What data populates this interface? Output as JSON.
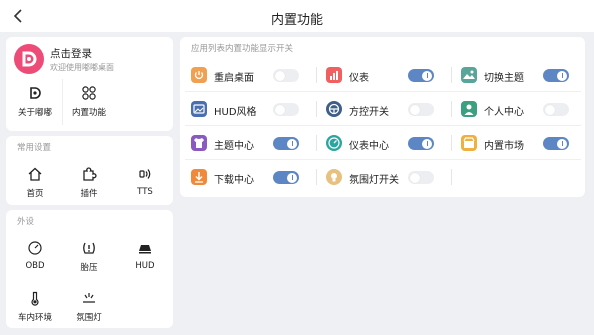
{
  "header": {
    "title": "内置功能"
  },
  "profile": {
    "name": "点击登录",
    "subtitle": "欢迎使用嘟嘟桌面",
    "items": [
      {
        "label": "关于嘟嘟",
        "icon": "dudu-logo-icon"
      },
      {
        "label": "内置功能",
        "icon": "grid-flower-icon"
      }
    ]
  },
  "common": {
    "title": "常用设置",
    "items": [
      {
        "label": "首页",
        "icon": "home-icon"
      },
      {
        "label": "插件",
        "icon": "puzzle-icon"
      },
      {
        "label": "TTS",
        "icon": "voice-icon"
      }
    ]
  },
  "peripherals": {
    "title": "外设",
    "items": [
      {
        "label": "OBD",
        "icon": "gauge-icon"
      },
      {
        "label": "胎压",
        "icon": "tire-pressure-icon"
      },
      {
        "label": "HUD",
        "icon": "hud-icon"
      },
      {
        "label": "车内环境",
        "icon": "thermometer-icon"
      },
      {
        "label": "氛围灯",
        "icon": "ambient-light-icon"
      }
    ]
  },
  "main": {
    "title": "应用列表内置功能显示开关",
    "apps": [
      {
        "label": "重启桌面",
        "icon": "power-icon",
        "color": "#f0a050",
        "enabled": false
      },
      {
        "label": "仪表",
        "icon": "dashboard-icon",
        "color": "#f06060",
        "enabled": true
      },
      {
        "label": "切换主题",
        "icon": "theme-icon",
        "color": "#5aa59a",
        "enabled": true
      },
      {
        "label": "HUD风格",
        "icon": "hud-style-icon",
        "color": "#4a6fb0",
        "enabled": false
      },
      {
        "label": "方控开关",
        "icon": "steering-wheel-icon",
        "color": "#3f5f8a",
        "enabled": false
      },
      {
        "label": "个人中心",
        "icon": "person-icon",
        "color": "#3aa080",
        "enabled": false
      },
      {
        "label": "主题中心",
        "icon": "shirt-icon",
        "color": "#8a5ac0",
        "enabled": true
      },
      {
        "label": "仪表中心",
        "icon": "speedometer-icon",
        "color": "#2aa5a0",
        "enabled": true
      },
      {
        "label": "内置市场",
        "icon": "market-icon",
        "color": "#f0b040",
        "enabled": true
      },
      {
        "label": "下载中心",
        "icon": "download-icon",
        "color": "#f08a3a",
        "enabled": true
      },
      {
        "label": "氛围灯开关",
        "icon": "bulb-icon",
        "color": "#e8c080",
        "enabled": false
      }
    ]
  }
}
